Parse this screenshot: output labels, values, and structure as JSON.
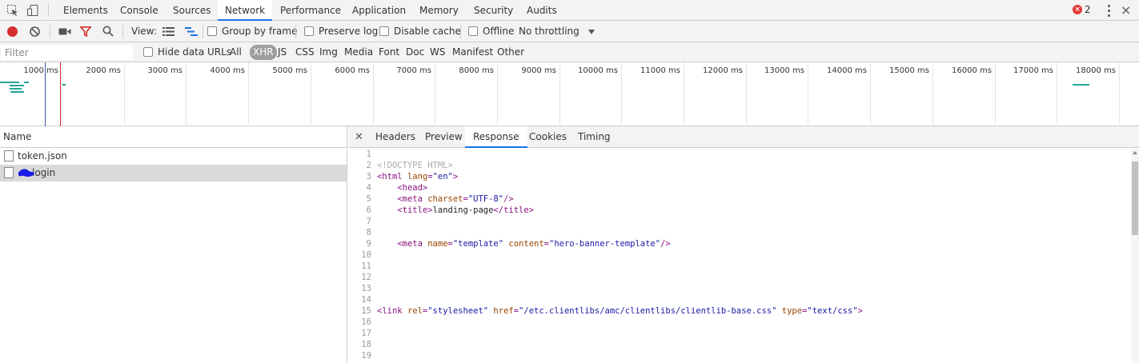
{
  "devtools_tabs": [
    "Elements",
    "Console",
    "Sources",
    "Network",
    "Performance",
    "Application",
    "Memory",
    "Security",
    "Audits"
  ],
  "active_tab": "Network",
  "error_count": "2",
  "toolbar": {
    "view_label": "View:",
    "group_by_frame": "Group by frame",
    "preserve_log": "Preserve log",
    "disable_cache": "Disable cache",
    "offline": "Offline",
    "throttling": "No throttling"
  },
  "filterbar": {
    "placeholder": "Filter",
    "hide_data_urls": "Hide data URLs",
    "types": [
      "All",
      "XHR",
      "JS",
      "CSS",
      "Img",
      "Media",
      "Font",
      "Doc",
      "WS",
      "Manifest",
      "Other"
    ],
    "selected_type": "XHR"
  },
  "overview": {
    "ticks": [
      "1000 ms",
      "2000 ms",
      "3000 ms",
      "4000 ms",
      "5000 ms",
      "6000 ms",
      "7000 ms",
      "8000 ms",
      "9000 ms",
      "10000 ms",
      "11000 ms",
      "12000 ms",
      "13000 ms",
      "14000 ms",
      "15000 ms",
      "16000 ms",
      "17000 ms",
      "18000 ms"
    ],
    "dom_content_loaded_color": "#3b5998",
    "load_color": "#c62828",
    "request_bar_color": "#26a69a"
  },
  "requests": {
    "column_name": "Name",
    "items": [
      {
        "name": "token.json",
        "selected": false
      },
      {
        "name": "login",
        "selected": true
      }
    ]
  },
  "detail_tabs": [
    "Headers",
    "Preview",
    "Response",
    "Cookies",
    "Timing"
  ],
  "active_detail_tab": "Response",
  "response_lines": [
    {
      "n": "1",
      "parts": []
    },
    {
      "n": "2",
      "parts": [
        {
          "t": "cmt",
          "s": "<!DOCTYPE HTML>"
        }
      ]
    },
    {
      "n": "3",
      "parts": [
        {
          "t": "tag",
          "s": "<html "
        },
        {
          "t": "attr",
          "s": "lang"
        },
        {
          "t": "tag",
          "s": "="
        },
        {
          "t": "val",
          "s": "\"en\""
        },
        {
          "t": "tag",
          "s": ">"
        }
      ]
    },
    {
      "n": "4",
      "parts": [
        {
          "t": "txt",
          "s": "    "
        },
        {
          "t": "tag",
          "s": "<head>"
        }
      ]
    },
    {
      "n": "5",
      "parts": [
        {
          "t": "txt",
          "s": "    "
        },
        {
          "t": "tag",
          "s": "<meta "
        },
        {
          "t": "attr",
          "s": "charset"
        },
        {
          "t": "tag",
          "s": "="
        },
        {
          "t": "val",
          "s": "\"UTF-8\""
        },
        {
          "t": "tag",
          "s": "/>"
        }
      ]
    },
    {
      "n": "6",
      "parts": [
        {
          "t": "txt",
          "s": "    "
        },
        {
          "t": "tag",
          "s": "<title>"
        },
        {
          "t": "txt",
          "s": "landing-page"
        },
        {
          "t": "tag",
          "s": "</title>"
        }
      ]
    },
    {
      "n": "7",
      "parts": []
    },
    {
      "n": "8",
      "parts": []
    },
    {
      "n": "9",
      "parts": [
        {
          "t": "txt",
          "s": "    "
        },
        {
          "t": "tag",
          "s": "<meta "
        },
        {
          "t": "attr",
          "s": "name"
        },
        {
          "t": "tag",
          "s": "="
        },
        {
          "t": "val",
          "s": "\"template\""
        },
        {
          "t": "txt",
          "s": " "
        },
        {
          "t": "attr",
          "s": "content"
        },
        {
          "t": "tag",
          "s": "="
        },
        {
          "t": "val",
          "s": "\"hero-banner-template\""
        },
        {
          "t": "tag",
          "s": "/>"
        }
      ]
    },
    {
      "n": "10",
      "parts": []
    },
    {
      "n": "11",
      "parts": []
    },
    {
      "n": "12",
      "parts": []
    },
    {
      "n": "13",
      "parts": []
    },
    {
      "n": "14",
      "parts": []
    },
    {
      "n": "15",
      "parts": [
        {
          "t": "tag",
          "s": "<link "
        },
        {
          "t": "attr",
          "s": "rel"
        },
        {
          "t": "tag",
          "s": "="
        },
        {
          "t": "val",
          "s": "\"stylesheet\""
        },
        {
          "t": "txt",
          "s": " "
        },
        {
          "t": "attr",
          "s": "href"
        },
        {
          "t": "tag",
          "s": "="
        },
        {
          "t": "val",
          "s": "\"/etc.clientlibs/amc/clientlibs/clientlib-base.css\""
        },
        {
          "t": "txt",
          "s": " "
        },
        {
          "t": "attr",
          "s": "type"
        },
        {
          "t": "tag",
          "s": "="
        },
        {
          "t": "val",
          "s": "\"text/css\""
        },
        {
          "t": "tag",
          "s": ">"
        }
      ]
    },
    {
      "n": "16",
      "parts": []
    },
    {
      "n": "17",
      "parts": []
    },
    {
      "n": "18",
      "parts": []
    },
    {
      "n": "19",
      "parts": []
    }
  ]
}
